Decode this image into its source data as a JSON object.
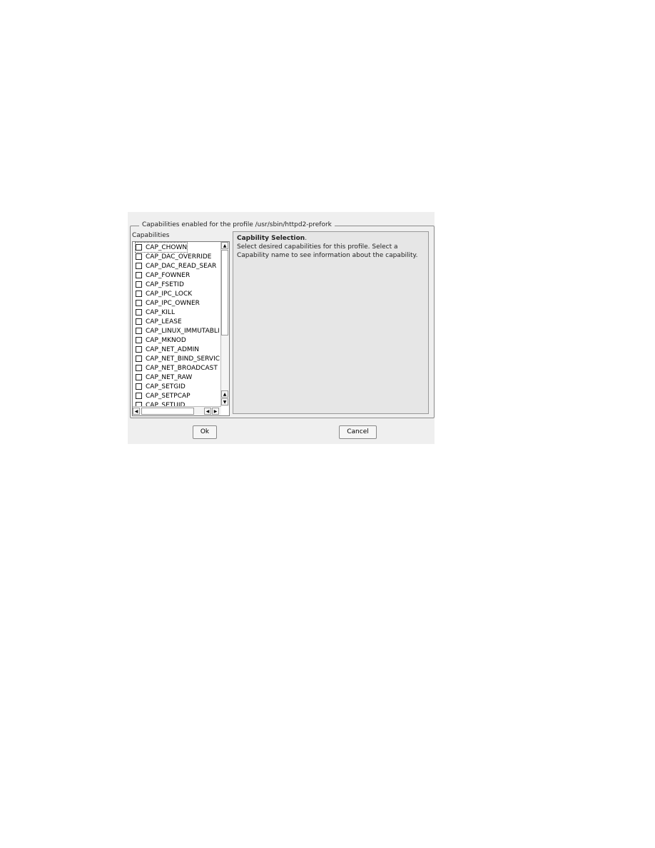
{
  "group_title": "Capabilities enabled for the profile /usr/sbin/httpd2-prefork",
  "list_label": "Capabilities",
  "capabilities": [
    {
      "label": "CAP_CHOWN",
      "checked": false
    },
    {
      "label": "CAP_DAC_OVERRIDE",
      "checked": false
    },
    {
      "label": "CAP_DAC_READ_SEAR",
      "checked": false
    },
    {
      "label": "CAP_FOWNER",
      "checked": false
    },
    {
      "label": "CAP_FSETID",
      "checked": false
    },
    {
      "label": "CAP_IPC_LOCK",
      "checked": false
    },
    {
      "label": "CAP_IPC_OWNER",
      "checked": false
    },
    {
      "label": "CAP_KILL",
      "checked": false
    },
    {
      "label": "CAP_LEASE",
      "checked": false
    },
    {
      "label": "CAP_LINUX_IMMUTABLI",
      "checked": false
    },
    {
      "label": "CAP_MKNOD",
      "checked": false
    },
    {
      "label": "CAP_NET_ADMIN",
      "checked": false
    },
    {
      "label": "CAP_NET_BIND_SERVIC",
      "checked": false
    },
    {
      "label": "CAP_NET_BROADCAST",
      "checked": false
    },
    {
      "label": "CAP_NET_RAW",
      "checked": false
    },
    {
      "label": "CAP_SETGID",
      "checked": false
    },
    {
      "label": "CAP_SETPCAP",
      "checked": false
    },
    {
      "label": "CAP_SETUID",
      "checked": false
    }
  ],
  "info": {
    "heading": "Capbility Selection",
    "text": "Select desired capabilities for this profile. Select a Capability name to see information about the capability."
  },
  "buttons": {
    "ok": "Ok",
    "cancel": "Cancel"
  }
}
